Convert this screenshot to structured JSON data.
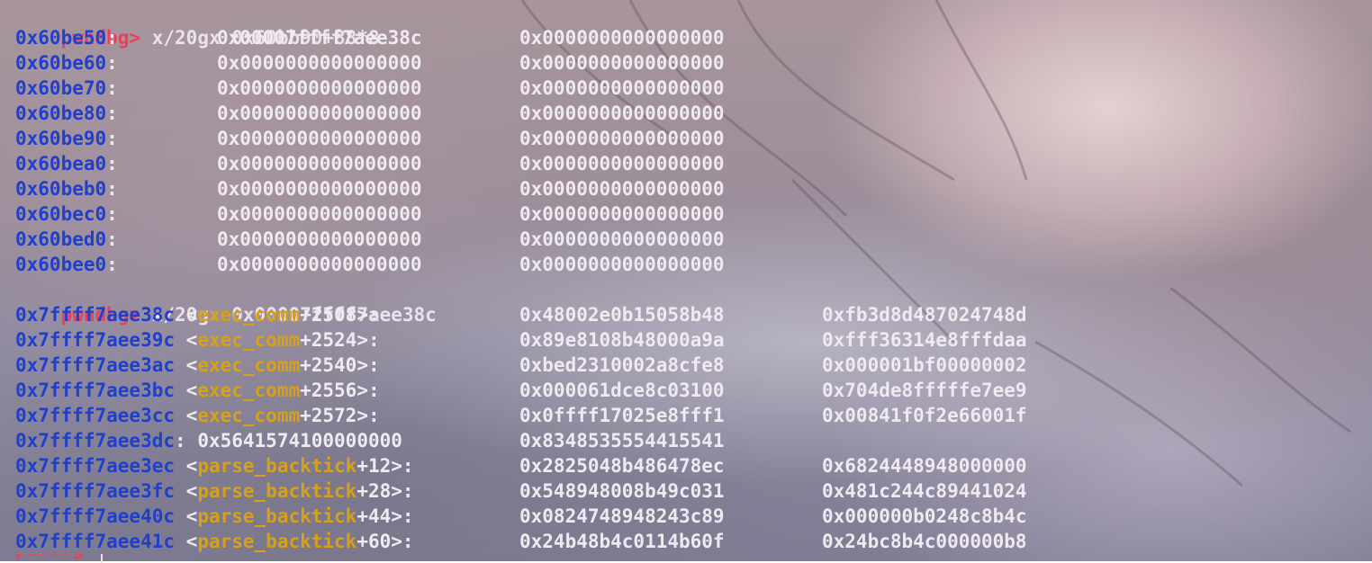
{
  "prompt": "pwndbg>",
  "commands": {
    "first": "x/20gx 0x60bb90+88*8",
    "second": "x/20gx 0x00007ffff7aee38c"
  },
  "dump1": [
    {
      "addr": "0x60be50",
      "v1": "0x00007ffff7aee38c",
      "v2": "0x0000000000000000"
    },
    {
      "addr": "0x60be60",
      "v1": "0x0000000000000000",
      "v2": "0x0000000000000000"
    },
    {
      "addr": "0x60be70",
      "v1": "0x0000000000000000",
      "v2": "0x0000000000000000"
    },
    {
      "addr": "0x60be80",
      "v1": "0x0000000000000000",
      "v2": "0x0000000000000000"
    },
    {
      "addr": "0x60be90",
      "v1": "0x0000000000000000",
      "v2": "0x0000000000000000"
    },
    {
      "addr": "0x60bea0",
      "v1": "0x0000000000000000",
      "v2": "0x0000000000000000"
    },
    {
      "addr": "0x60beb0",
      "v1": "0x0000000000000000",
      "v2": "0x0000000000000000"
    },
    {
      "addr": "0x60bec0",
      "v1": "0x0000000000000000",
      "v2": "0x0000000000000000"
    },
    {
      "addr": "0x60bed0",
      "v1": "0x0000000000000000",
      "v2": "0x0000000000000000"
    },
    {
      "addr": "0x60bee0",
      "v1": "0x0000000000000000",
      "v2": "0x0000000000000000"
    }
  ],
  "dump2": [
    {
      "addr": "0x7ffff7aee38c",
      "sym": "exec_comm",
      "off": "+2508>:",
      "v1": "0x48002e0b15058b48",
      "v2": "0xfb3d8d487024748d"
    },
    {
      "addr": "0x7ffff7aee39c",
      "sym": "exec_comm",
      "off": "+2524>:",
      "v1": "0x89e8108b48000a9a",
      "v2": "0xfff36314e8fffdaa"
    },
    {
      "addr": "0x7ffff7aee3ac",
      "sym": "exec_comm",
      "off": "+2540>:",
      "v1": "0xbed2310002a8cfe8",
      "v2": "0x000001bf00000002"
    },
    {
      "addr": "0x7ffff7aee3bc",
      "sym": "exec_comm",
      "off": "+2556>:",
      "v1": "0x000061dce8c03100",
      "v2": "0x704de8fffffe7ee9"
    },
    {
      "addr": "0x7ffff7aee3cc",
      "sym": "exec_comm",
      "off": "+2572>:",
      "v1": "0x0ffff17025e8fff1",
      "v2": "0x00841f0f2e66001f"
    },
    {
      "addr": "0x7ffff7aee3dc",
      "sym": "",
      "off": "",
      "v0": "0x5641574100000000",
      "v1": "0x8348535554415541",
      "v2": ""
    },
    {
      "addr": "0x7ffff7aee3ec",
      "sym": "parse_backtick",
      "off": "+12>:",
      "v1": "0x2825048b486478ec",
      "v2": "0x6824448948000000"
    },
    {
      "addr": "0x7ffff7aee3fc",
      "sym": "parse_backtick",
      "off": "+28>:",
      "v1": "0x548948008b49c031",
      "v2": "0x481c244c89441024"
    },
    {
      "addr": "0x7ffff7aee40c",
      "sym": "parse_backtick",
      "off": "+44>:",
      "v1": "0x0824748948243c89",
      "v2": "0x000000b0248c8b4c"
    },
    {
      "addr": "0x7ffff7aee41c",
      "sym": "parse_backtick",
      "off": "+60>:",
      "v1": "0x24b48b4c0114b60f",
      "v2": "0x24bc8b4c000000b8"
    }
  ]
}
